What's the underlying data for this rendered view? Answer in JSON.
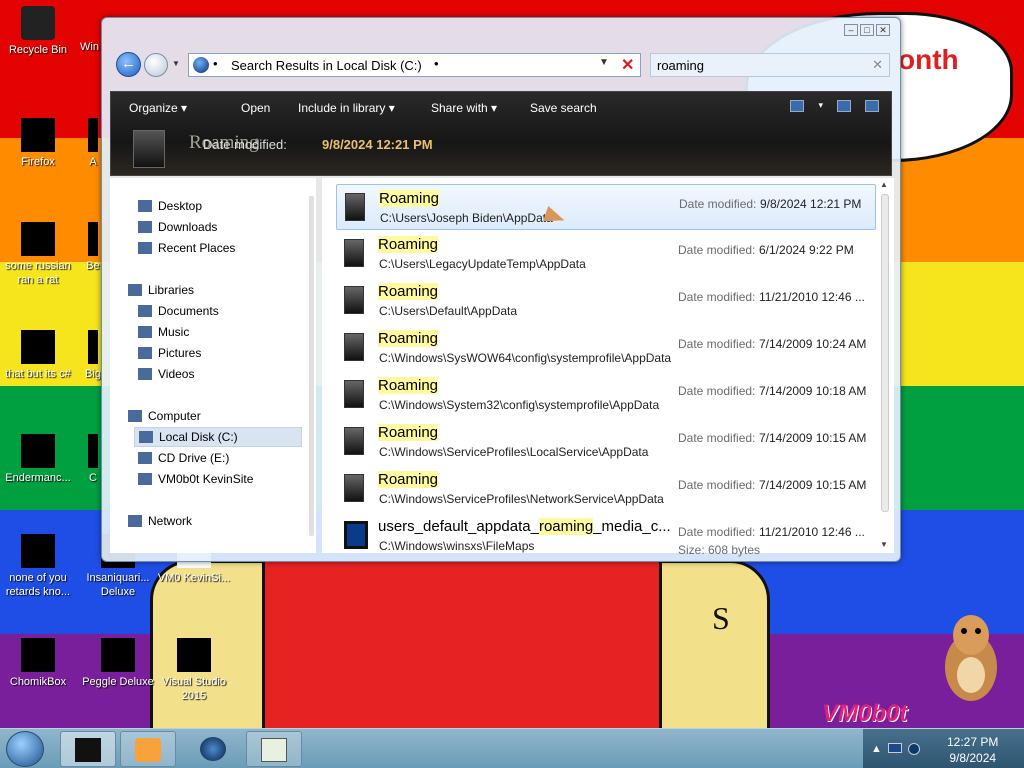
{
  "desktop": {
    "bubble_text": "onth",
    "brand_text": "VM0b0t",
    "figure_mark": "S",
    "icons": [
      {
        "label": "Recycle Bin",
        "icon": "recycle-bin-icon"
      },
      {
        "label": "Firefox",
        "icon": "firefox-icon"
      },
      {
        "label": "some russian ran a rat",
        "icon": "shortcut-icon"
      },
      {
        "label": "that but its c#",
        "icon": "folder-icon"
      },
      {
        "label": "Endermanc...",
        "icon": "app-icon"
      },
      {
        "label": "none of you retards kno...",
        "icon": "app-icon"
      },
      {
        "label": "ChomikBox",
        "icon": "chomikbox-icon"
      },
      {
        "label": "Peggle Deluxe",
        "icon": "peggle-icon"
      },
      {
        "label": "Visual Studio 2015",
        "icon": "visual-studio-icon"
      },
      {
        "label": "Insaniquari... Deluxe",
        "icon": "game-icon"
      },
      {
        "label": "VM0 KevinSi...",
        "icon": "app-icon"
      },
      {
        "label": "Win",
        "icon": "app-icon"
      },
      {
        "label": "A",
        "icon": "app-icon"
      },
      {
        "label": "Be",
        "icon": "app-icon"
      },
      {
        "label": "Big",
        "icon": "app-icon"
      },
      {
        "label": "C",
        "icon": "app-icon"
      }
    ]
  },
  "window": {
    "caption_buttons": [
      "‒",
      "□",
      "✕"
    ],
    "address": {
      "text": "Search Results in Local Disk (C:)",
      "sep": "•",
      "dropdown": "▼",
      "clear": "✕"
    },
    "search": {
      "value": "roaming",
      "clear": "✕"
    },
    "toolbar": {
      "organize": "Organize ▾",
      "open": "Open",
      "include": "Include in library ▾",
      "share": "Share with ▾",
      "save_search": "Save search",
      "view_caret": "▾"
    },
    "details": {
      "name": "Roaming",
      "label": "Date modified:",
      "value": "9/8/2024 12:21 PM"
    },
    "nav": {
      "items": [
        {
          "label": "Desktop",
          "indent": true
        },
        {
          "label": "Downloads",
          "indent": true
        },
        {
          "label": "Recent Places",
          "indent": true
        },
        {
          "label": "Libraries",
          "indent": false
        },
        {
          "label": "Documents",
          "indent": true
        },
        {
          "label": "Music",
          "indent": true
        },
        {
          "label": "Pictures",
          "indent": true
        },
        {
          "label": "Videos",
          "indent": true
        },
        {
          "label": "Computer",
          "indent": false
        },
        {
          "label": "Local Disk (C:)",
          "indent": true,
          "selected": true
        },
        {
          "label": "CD Drive (E:)",
          "indent": true
        },
        {
          "label": "VM0b0t KevinSite",
          "indent": true
        },
        {
          "label": "Network",
          "indent": false
        }
      ]
    },
    "results": [
      {
        "name_pre": "",
        "name_hl": "Roaming",
        "name_post": "",
        "path": "C:\\Users\\Joseph Biden\\AppData",
        "meta_label": "Date modified:",
        "meta_value": "9/8/2024 12:21 PM",
        "selected": true
      },
      {
        "name_pre": "",
        "name_hl": "Roaming",
        "name_post": "",
        "path": "C:\\Users\\LegacyUpdateTemp\\AppData",
        "meta_label": "Date modified:",
        "meta_value": "6/1/2024 9:22 PM"
      },
      {
        "name_pre": "",
        "name_hl": "Roaming",
        "name_post": "",
        "path": "C:\\Users\\Default\\AppData",
        "meta_label": "Date modified:",
        "meta_value": "11/21/2010 12:46 ..."
      },
      {
        "name_pre": "",
        "name_hl": "Roaming",
        "name_post": "",
        "path": "C:\\Windows\\SysWOW64\\config\\systemprofile\\AppData",
        "meta_label": "Date modified:",
        "meta_value": "7/14/2009 10:24 AM"
      },
      {
        "name_pre": "",
        "name_hl": "Roaming",
        "name_post": "",
        "path": "C:\\Windows\\System32\\config\\systemprofile\\AppData",
        "meta_label": "Date modified:",
        "meta_value": "7/14/2009 10:18 AM"
      },
      {
        "name_pre": "",
        "name_hl": "Roaming",
        "name_post": "",
        "path": "C:\\Windows\\ServiceProfiles\\LocalService\\AppData",
        "meta_label": "Date modified:",
        "meta_value": "7/14/2009 10:15 AM"
      },
      {
        "name_pre": "",
        "name_hl": "Roaming",
        "name_post": "",
        "path": "C:\\Windows\\ServiceProfiles\\NetworkService\\AppData",
        "meta_label": "Date modified:",
        "meta_value": "7/14/2009 10:15 AM"
      },
      {
        "name_pre": "users_default_appdata_",
        "name_hl": "roaming",
        "name_post": "_media_c...",
        "path": "C:\\Windows\\winsxs\\FileMaps",
        "meta_label": "Date modified:",
        "meta_value": "11/21/2010 12:46 ...",
        "size": "Size: 608 bytes",
        "is_file": true
      }
    ]
  },
  "taskbar": {
    "clock_time": "12:27 PM",
    "clock_date": "9/8/2024",
    "tray_caret": "▲"
  }
}
